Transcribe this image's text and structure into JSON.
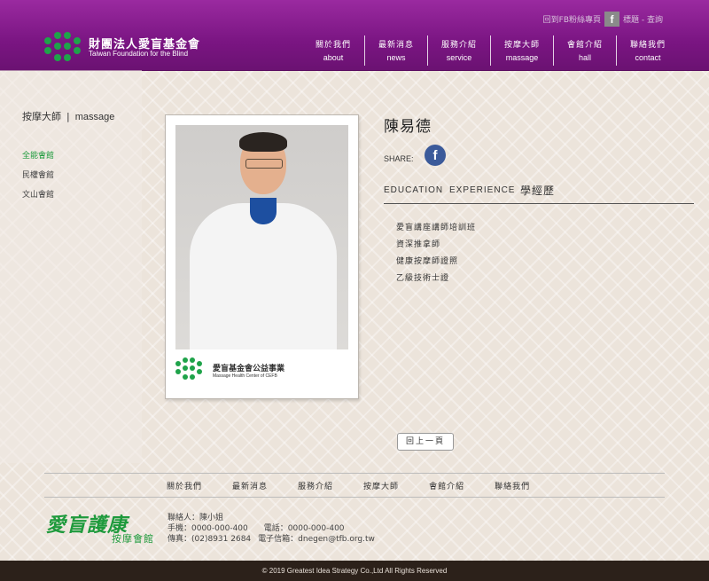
{
  "header": {
    "logo_cn": "財團法人愛盲基金會",
    "logo_en": "Taiwan Foundation for the Blind",
    "util_text_left": "回到FB粉絲專頁",
    "util_fb_icon": "f",
    "util_text_right": "標題 - 查詢",
    "nav": [
      {
        "cn": "關於我們",
        "en": "about"
      },
      {
        "cn": "最新消息",
        "en": "news"
      },
      {
        "cn": "服務介紹",
        "en": "service"
      },
      {
        "cn": "按摩大師",
        "en": "massage"
      },
      {
        "cn": "會館介紹",
        "en": "hall"
      },
      {
        "cn": "聯絡我們",
        "en": "contact"
      }
    ]
  },
  "sidebar": {
    "title_cn": "按摩大師",
    "title_sep": "|",
    "title_en": "massage",
    "branches": [
      "全能會館",
      "民權會館",
      "文山會館"
    ]
  },
  "card": {
    "logo_cn": "愛盲基金會公益事業",
    "logo_en": "Massage Health Center of CEFB"
  },
  "detail": {
    "name": "陳易德",
    "share_label": "SHARE:",
    "share_fb": "f",
    "tabs": [
      "EDUCATION",
      "EXPERIENCE",
      "學經歷"
    ],
    "items": [
      "愛盲講座講師培訓班",
      "資深推拿師",
      "健康按摩師證照",
      "乙級技術士證"
    ],
    "back_label": "回上一頁"
  },
  "footer": {
    "nav": [
      "關於我們",
      "最新消息",
      "服務介紹",
      "按摩大師",
      "會館介紹",
      "聯絡我們"
    ],
    "logo_big": "愛盲護康",
    "logo_small": "按摩會館",
    "contact_person": "聯絡人：陳小姐",
    "phone": "手機：0000-000-400",
    "fax": "電話：0000-000-400",
    "tel": "傳真：(02)8931 2684",
    "email": "電子信箱：dnegen@tfb.org.tw",
    "copyright": "© 2019 Greatest Idea Strategy Co.,Ltd All Rights Reserved"
  },
  "colors": {
    "header_purple": "#7a1582",
    "brand_green": "#1e9a3c",
    "footer_bar": "#2c211a"
  }
}
